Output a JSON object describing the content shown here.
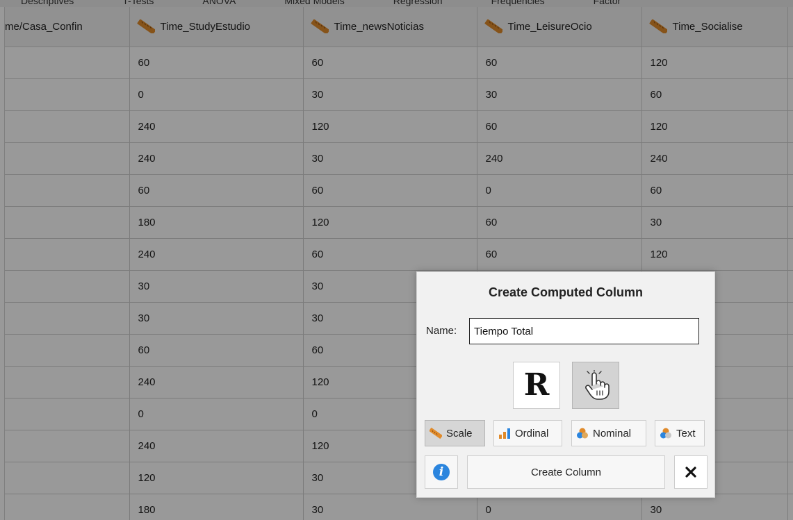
{
  "top_menu": {
    "items": [
      "Descriptives",
      "T-Tests",
      "ANOVA",
      "Mixed Models",
      "Regression",
      "Frequencies",
      "Factor"
    ]
  },
  "spreadsheet": {
    "columns": [
      {
        "label": "me/Casa_Confin",
        "icon": ""
      },
      {
        "label": "Time_StudyEstudio",
        "icon": "ruler-icon"
      },
      {
        "label": "Time_newsNoticias",
        "icon": "ruler-icon"
      },
      {
        "label": "Time_LeisureOcio",
        "icon": "ruler-icon"
      },
      {
        "label": "Time_Socialise",
        "icon": "ruler-icon"
      },
      {
        "label": "",
        "icon": ""
      }
    ],
    "rows": [
      [
        "",
        "60",
        "60",
        "60",
        "120",
        ""
      ],
      [
        "",
        "0",
        "30",
        "30",
        "60",
        ""
      ],
      [
        "",
        "240",
        "120",
        "60",
        "120",
        ""
      ],
      [
        "",
        "240",
        "30",
        "240",
        "240",
        ""
      ],
      [
        "",
        "60",
        "60",
        "0",
        "60",
        ""
      ],
      [
        "",
        "180",
        "120",
        "60",
        "30",
        ""
      ],
      [
        "",
        "240",
        "60",
        "60",
        "120",
        ""
      ],
      [
        "",
        "30",
        "30",
        "",
        "",
        ""
      ],
      [
        "",
        "30",
        "30",
        "",
        "",
        ""
      ],
      [
        "",
        "60",
        "60",
        "",
        "",
        ""
      ],
      [
        "",
        "240",
        "120",
        "",
        "",
        ""
      ],
      [
        "",
        "0",
        "0",
        "",
        "",
        ""
      ],
      [
        "",
        "240",
        "120",
        "",
        "",
        ""
      ],
      [
        "",
        "120",
        "30",
        "",
        "",
        ""
      ],
      [
        "",
        "180",
        "30",
        "0",
        "30",
        ""
      ]
    ]
  },
  "dialog": {
    "title": "Create Computed Column",
    "name_label": "Name:",
    "name_value": "Tiempo Total",
    "r_button_label": "R",
    "types": [
      {
        "label": "Scale",
        "icon": "ruler-icon",
        "selected": true
      },
      {
        "label": "Ordinal",
        "icon": "bar-chart-icon",
        "selected": false
      },
      {
        "label": "Nominal",
        "icon": "venn-icon",
        "selected": false
      },
      {
        "label": "Text",
        "icon": "venn-text-icon",
        "selected": false
      }
    ],
    "info_glyph": "i",
    "create_label": "Create Column",
    "close_icon": "close-icon"
  },
  "colors": {
    "overlay": "#000000",
    "dialog_bg": "#f1f1f1",
    "info_blue": "#2b85de",
    "ruler_orange": "#e08a2a"
  }
}
